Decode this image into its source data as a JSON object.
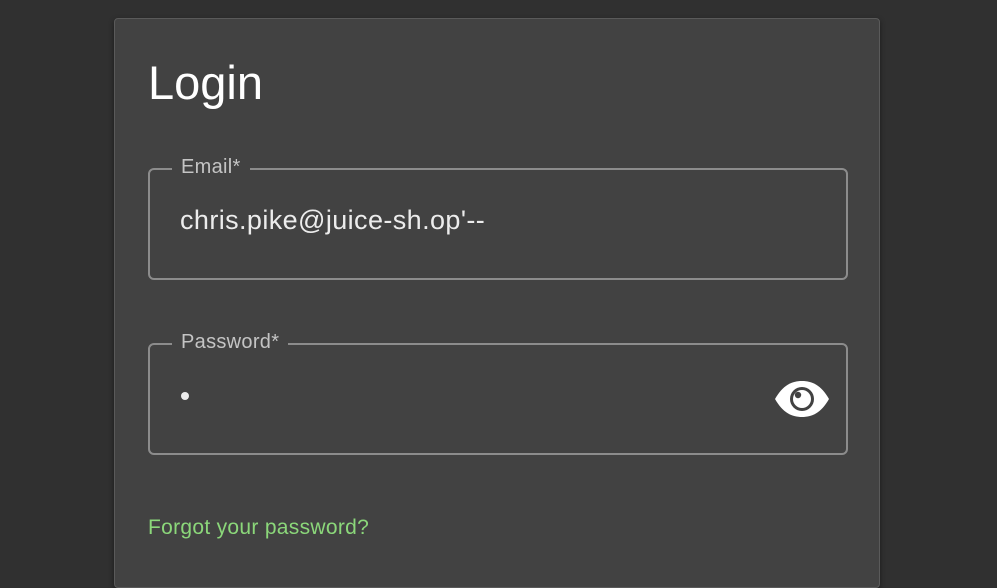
{
  "login": {
    "title": "Login",
    "email": {
      "label": "Email*",
      "value": "chris.pike@juice-sh.op'--"
    },
    "password": {
      "label": "Password*",
      "masked_value": "•",
      "visibility_icon": "eye-icon"
    },
    "forgot_password_link": "Forgot your password?"
  },
  "colors": {
    "page_background": "#303030",
    "card_background": "#424242",
    "field_border": "#8c8c8c",
    "link": "#8bd77a",
    "text": "#ffffff"
  }
}
